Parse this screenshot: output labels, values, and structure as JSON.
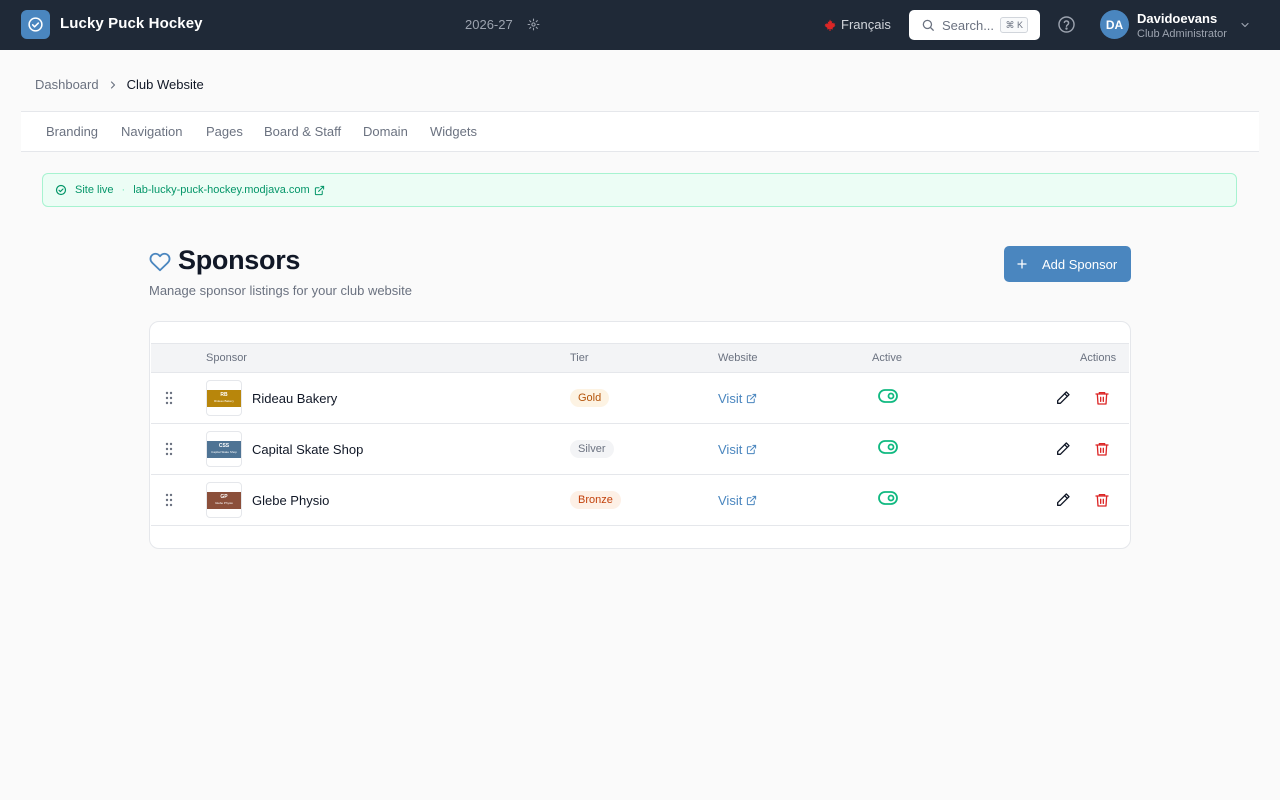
{
  "app": {
    "title": "Lucky Puck Hockey",
    "season": "2026-27"
  },
  "header": {
    "language": "Français",
    "search_placeholder": "Search...",
    "search_shortcut": "⌘ K",
    "user_initials": "DA",
    "user_name": "Davidoevans",
    "user_role": "Club Administrator"
  },
  "breadcrumb": [
    "Dashboard",
    "Club Website"
  ],
  "tabs": [
    "Branding",
    "Navigation",
    "Pages",
    "Board & Staff",
    "Domain",
    "Widgets"
  ],
  "banner": {
    "status": "Site live",
    "separator": "·",
    "url": "lab-lucky-puck-hockey.modjava.com"
  },
  "page": {
    "title": "Sponsors",
    "subtitle": "Manage sponsor listings for your club website",
    "add_label": "Add Sponsor"
  },
  "table": {
    "columns": [
      "Sponsor",
      "Tier",
      "Website",
      "Active",
      "Actions"
    ],
    "rows": [
      {
        "name": "Rideau Bakery",
        "logo_text": "RB",
        "logo_sub": "Rideau Bakery",
        "logo_color": "#b8860b",
        "tier": "Gold",
        "website_label": "Visit",
        "active": true
      },
      {
        "name": "Capital Skate Shop",
        "logo_text": "CSS",
        "logo_sub": "Capital Skate Shop",
        "logo_color": "#4e7394",
        "tier": "Silver",
        "website_label": "Visit",
        "active": true
      },
      {
        "name": "Glebe Physio",
        "logo_text": "GP",
        "logo_sub": "Glebe Physio",
        "logo_color": "#8b4f3a",
        "tier": "Bronze",
        "website_label": "Visit",
        "active": true
      }
    ]
  },
  "colors": {
    "topbar": "#1f2937",
    "accent": "#4a86bf",
    "success": "#10b981",
    "danger": "#dc2626",
    "gold_bg": "#fdf3e3",
    "gold_fg": "#b45309",
    "silver_bg": "#f3f4f6",
    "silver_fg": "#6b7280",
    "bronze_bg": "#fdf0e6",
    "bronze_fg": "#c2410c"
  },
  "icons": {
    "logo": "check-circle-icon",
    "season_settings": "gear-icon",
    "language_flag": "maple-leaf-icon",
    "search": "search-icon",
    "help": "help-circle-icon",
    "user_menu": "chevron-down-icon",
    "breadcrumb_separator": "chevron-right-icon",
    "banner_status": "check-circle-icon",
    "external_link": "external-link-icon",
    "page_title": "heart-icon",
    "add": "plus-icon",
    "row_drag": "drag-handle-icon",
    "active_toggle": "toggle-on-icon",
    "edit": "pencil-icon",
    "delete": "trash-icon"
  }
}
